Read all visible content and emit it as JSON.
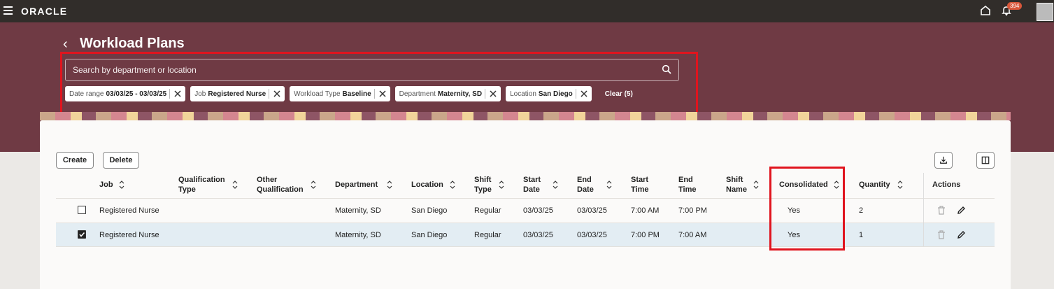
{
  "topbar": {
    "logo": "ORACLE",
    "notification_count": "394"
  },
  "page": {
    "title": "Workload Plans"
  },
  "search": {
    "placeholder": "Search by department or location"
  },
  "filters": [
    {
      "label": "Date range",
      "value": "03/03/25 - 03/03/25"
    },
    {
      "label": "Job",
      "value": "Registered Nurse"
    },
    {
      "label": "Workload Type",
      "value": "Baseline"
    },
    {
      "label": "Department",
      "value": "Maternity, SD"
    },
    {
      "label": "Location",
      "value": "San Diego"
    }
  ],
  "clear_label": "Clear (5)",
  "toolbar": {
    "create_label": "Create",
    "delete_label": "Delete"
  },
  "table": {
    "columns": [
      {
        "l1": "Job",
        "l2": ""
      },
      {
        "l1": "Qualification",
        "l2": "Type"
      },
      {
        "l1": "Other",
        "l2": "Qualification"
      },
      {
        "l1": "Department",
        "l2": ""
      },
      {
        "l1": "Location",
        "l2": ""
      },
      {
        "l1": "Shift",
        "l2": "Type"
      },
      {
        "l1": "Start",
        "l2": "Date"
      },
      {
        "l1": "End",
        "l2": "Date"
      },
      {
        "l1": "Start",
        "l2": "Time"
      },
      {
        "l1": "End",
        "l2": "Time"
      },
      {
        "l1": "Shift",
        "l2": "Name"
      },
      {
        "l1": "Consolidated",
        "l2": ""
      },
      {
        "l1": "Quantity",
        "l2": ""
      },
      {
        "l1": "Actions",
        "l2": ""
      }
    ],
    "rows": [
      {
        "selected": false,
        "job": "Registered Nurse",
        "department": "Maternity, SD",
        "location": "San Diego",
        "shift_type": "Regular",
        "start_date": "03/03/25",
        "end_date": "03/03/25",
        "start_time": "7:00 AM",
        "end_time": "7:00 PM",
        "consolidated": "Yes",
        "quantity": "2"
      },
      {
        "selected": true,
        "job": "Registered Nurse",
        "department": "Maternity, SD",
        "location": "San Diego",
        "shift_type": "Regular",
        "start_date": "03/03/25",
        "end_date": "03/03/25",
        "start_time": "7:00 PM",
        "end_time": "7:00 AM",
        "consolidated": "Yes",
        "quantity": "1"
      }
    ]
  },
  "colors": {
    "banner": "#6f3a44",
    "highlight": "#e0141e",
    "selected_row": "#e3edf3"
  }
}
